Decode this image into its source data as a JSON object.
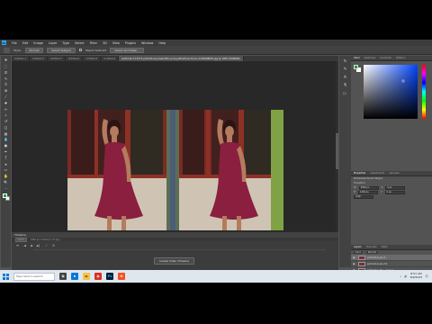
{
  "app": {
    "menu": [
      "File",
      "Edit",
      "Image",
      "Layer",
      "Type",
      "Select",
      "Filter",
      "3D",
      "View",
      "Plugins",
      "Window",
      "Help"
    ]
  },
  "options_bar": {
    "style_label": "Style:",
    "style_value": "Normal",
    "select_subject": "Select Subject",
    "object_label": "Object Subtract",
    "select_mask": "Select and Mask..."
  },
  "tabs": [
    {
      "label": "Untitled-1",
      "active": false
    },
    {
      "label": "Untitled-2",
      "active": false
    },
    {
      "label": "Untitled-3",
      "active": false
    },
    {
      "label": "Untitled-4",
      "active": false
    },
    {
      "label": "Untitled-5",
      "active": false
    },
    {
      "label": "Untitled-6",
      "active": false
    },
    {
      "label": "sukhman-f-t-3371-portrait-very-beautiful-young-attractive-3d-ren-1234698670.jpg @ 100% (RGB/8#)",
      "active": true
    }
  ],
  "timeline": {
    "title": "Timeline",
    "status_segments": [
      "100%",
      "3340 px x 2160 px (72 ppi)"
    ],
    "create_button": "Create Video Timeline"
  },
  "right_panels": {
    "color_tabs": [
      "Color",
      "Swatches",
      "Gradients",
      "Patterns"
    ],
    "accent_fg": "#1f9e3e",
    "properties_tabs": [
      "Properties",
      "Adjustments",
      "Libraries"
    ],
    "properties_title": "Embedded Smart Object",
    "transform_label": "Transform",
    "fields": [
      {
        "label": "W",
        "value": "2560 px"
      },
      {
        "label": "H",
        "value": "1440 px"
      },
      {
        "label": "X",
        "value": "0 px"
      },
      {
        "label": "Y",
        "value": "0 px"
      }
    ],
    "angle_value": "0.00°",
    "layers_tabs": [
      "Layers",
      "Channels",
      "Paths"
    ],
    "layers_kind": "Kind",
    "layers_mode": "Normal",
    "layers": [
      {
        "name": "portrait-w-pro-f...",
        "selected": true,
        "white": false
      },
      {
        "name": "portrait-w-pro-f-2",
        "selected": false,
        "white": false
      },
      {
        "name": "portrait-w-f-3... (copy)",
        "selected": false,
        "white": false
      },
      {
        "name": "Layer 1",
        "selected": false,
        "white": true
      },
      {
        "name": "Background",
        "selected": false,
        "white": true
      }
    ]
  },
  "taskbar": {
    "search_placeholder": "Type here to search",
    "time": "8:51 AM",
    "date": "8/9/2023"
  }
}
